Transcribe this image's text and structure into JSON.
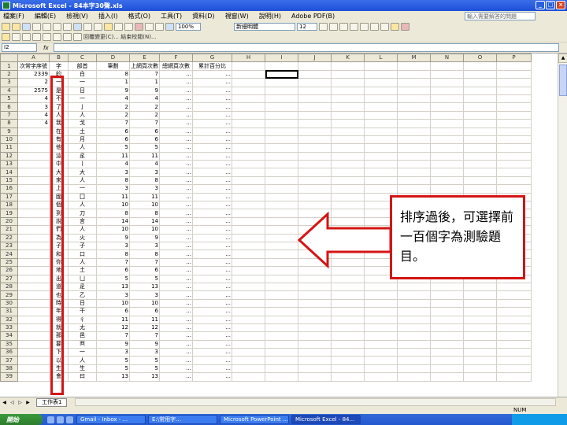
{
  "window": {
    "title": "Microsoft Excel - 84本字30聲.xls"
  },
  "menu": {
    "items": [
      "檔案(F)",
      "編輯(E)",
      "檢視(V)",
      "插入(I)",
      "格式(O)",
      "工具(T)",
      "資料(D)",
      "視窗(W)",
      "說明(H)",
      "Adobe PDF(B)"
    ],
    "help_placeholder": "輸入需要解答的問題"
  },
  "toolbar": {
    "font_name": "新細明體",
    "font_size": "12",
    "zoom": "100%",
    "row3_text": "回覆變更(C)... 結束校閱(N)..."
  },
  "formula": {
    "namebox": "I2",
    "fx": "fx"
  },
  "grid": {
    "col_headers": [
      "A",
      "B",
      "C",
      "D",
      "E",
      "F",
      "G",
      "H",
      "I",
      "J",
      "K",
      "L",
      "M",
      "N",
      "O",
      "P"
    ],
    "header_row": [
      "次常字序號",
      "字",
      "部首",
      "筆劃",
      "上網頁次數",
      "總網頁次數",
      "累計百分比"
    ],
    "rows": [
      [
        "2",
        "2339",
        "的",
        "白",
        "8",
        "7",
        "...",
        "...",
        ""
      ],
      [
        "3",
        "2",
        "一",
        "一",
        "1",
        "1",
        "...",
        "...",
        ""
      ],
      [
        "4",
        "2575",
        "是",
        "日",
        "9",
        "9",
        "...",
        "...",
        ""
      ],
      [
        "5",
        "4",
        "不",
        "一",
        "4",
        "4",
        "...",
        "...",
        ""
      ],
      [
        "6",
        "3",
        "了",
        "亅",
        "2",
        "2",
        "...",
        "...",
        ""
      ],
      [
        "7",
        "4",
        "人",
        "人",
        "2",
        "2",
        "...",
        "...",
        ""
      ],
      [
        "8",
        "4",
        "我",
        "戈",
        "7",
        "7",
        "...",
        "...",
        ""
      ],
      [
        "9",
        "",
        "在",
        "土",
        "6",
        "6",
        "...",
        "...",
        ""
      ],
      [
        "10",
        "",
        "有",
        "月",
        "6",
        "6",
        "...",
        "...",
        ""
      ],
      [
        "11",
        "",
        "他",
        "人",
        "5",
        "5",
        "...",
        "...",
        ""
      ],
      [
        "12",
        "",
        "這",
        "辵",
        "11",
        "11",
        "...",
        "...",
        ""
      ],
      [
        "13",
        "",
        "中",
        "丨",
        "4",
        "4",
        "...",
        "...",
        ""
      ],
      [
        "14",
        "",
        "大",
        "大",
        "3",
        "3",
        "...",
        "...",
        ""
      ],
      [
        "15",
        "",
        "來",
        "人",
        "8",
        "8",
        "...",
        "...",
        ""
      ],
      [
        "16",
        "",
        "上",
        "一",
        "3",
        "3",
        "...",
        "...",
        ""
      ],
      [
        "17",
        "",
        "國",
        "囗",
        "11",
        "11",
        "...",
        "...",
        ""
      ],
      [
        "18",
        "",
        "個",
        "人",
        "10",
        "10",
        "...",
        "...",
        ""
      ],
      [
        "19",
        "",
        "到",
        "刀",
        "8",
        "8",
        "...",
        "...",
        ""
      ],
      [
        "20",
        "",
        "說",
        "言",
        "14",
        "14",
        "...",
        "...",
        ""
      ],
      [
        "21",
        "",
        "們",
        "人",
        "10",
        "10",
        "...",
        "...",
        ""
      ],
      [
        "22",
        "",
        "為",
        "火",
        "9",
        "9",
        "...",
        "...",
        ""
      ],
      [
        "23",
        "",
        "子",
        "子",
        "3",
        "3",
        "...",
        "...",
        ""
      ],
      [
        "24",
        "",
        "和",
        "口",
        "8",
        "8",
        "...",
        "...",
        ""
      ],
      [
        "25",
        "",
        "你",
        "人",
        "7",
        "7",
        "...",
        "...",
        ""
      ],
      [
        "26",
        "",
        "地",
        "土",
        "6",
        "6",
        "...",
        "...",
        ""
      ],
      [
        "27",
        "",
        "出",
        "凵",
        "5",
        "5",
        "...",
        "...",
        ""
      ],
      [
        "28",
        "",
        "道",
        "辵",
        "13",
        "13",
        "...",
        "...",
        ""
      ],
      [
        "29",
        "",
        "也",
        "乙",
        "3",
        "3",
        "...",
        "...",
        ""
      ],
      [
        "30",
        "",
        "時",
        "日",
        "10",
        "10",
        "...",
        "...",
        ""
      ],
      [
        "31",
        "",
        "年",
        "干",
        "6",
        "6",
        "...",
        "...",
        ""
      ],
      [
        "32",
        "",
        "得",
        "彳",
        "11",
        "11",
        "...",
        "...",
        ""
      ],
      [
        "33",
        "",
        "就",
        "尢",
        "12",
        "12",
        "...",
        "...",
        ""
      ],
      [
        "34",
        "",
        "那",
        "邑",
        "7",
        "7",
        "...",
        "...",
        ""
      ],
      [
        "35",
        "",
        "要",
        "襾",
        "9",
        "9",
        "...",
        "...",
        ""
      ],
      [
        "36",
        "",
        "下",
        "一",
        "3",
        "3",
        "...",
        "...",
        ""
      ],
      [
        "37",
        "",
        "以",
        "人",
        "5",
        "5",
        "...",
        "...",
        ""
      ],
      [
        "38",
        "",
        "生",
        "生",
        "5",
        "5",
        "...",
        "...",
        ""
      ],
      [
        "39",
        "",
        "會",
        "曰",
        "13",
        "13",
        "...",
        "...",
        ""
      ]
    ]
  },
  "sheet_tabs": {
    "active": "工作表1"
  },
  "status": {
    "ready": "",
    "num": "NUM"
  },
  "taskbar": {
    "start": "開始",
    "tasks": [
      "Gmail - Inbox - ...",
      "E:\\常用字...",
      "Microsoft PowerPoint ...",
      "Microsoft Excel - 84..."
    ],
    "clock": ""
  },
  "annotation": {
    "callout_text": "排序過後，可選擇前一百個字為測驗題目。",
    "color": "#d41414"
  }
}
